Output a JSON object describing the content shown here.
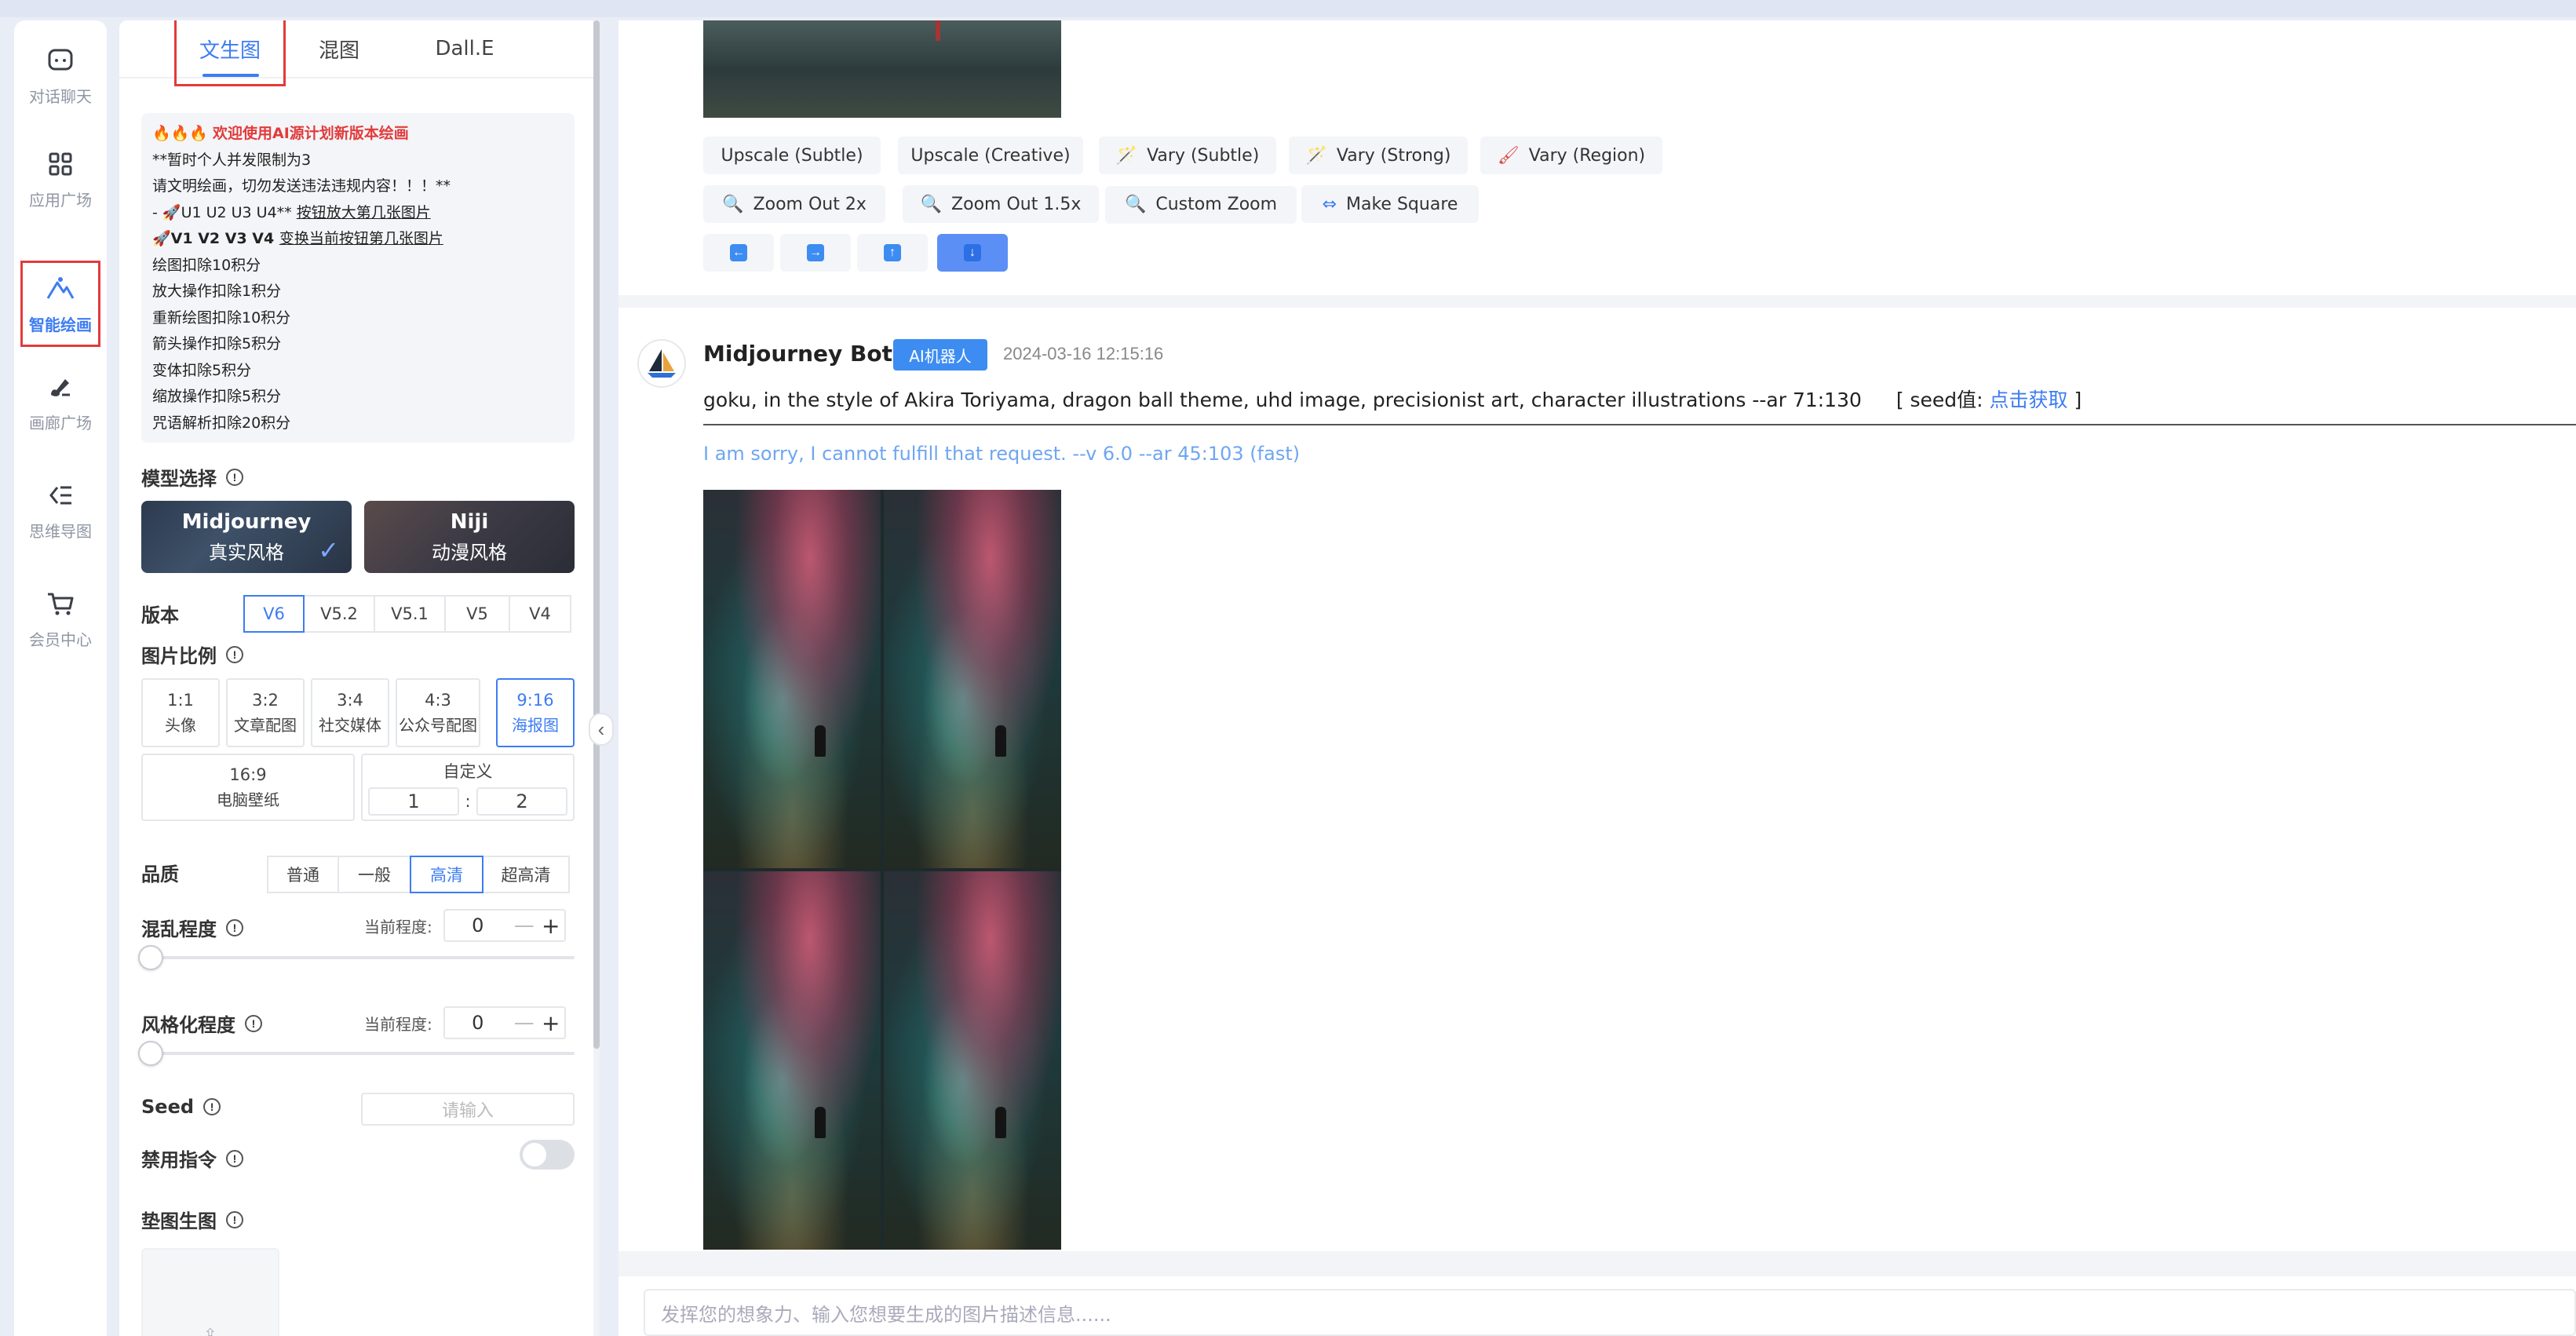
{
  "nav": {
    "items": [
      {
        "label": "对话聊天",
        "icon": "chat-icon"
      },
      {
        "label": "应用广场",
        "icon": "apps-grid-icon"
      },
      {
        "label": "智能绘画",
        "icon": "mountain-paint-icon",
        "active": true
      },
      {
        "label": "画廊广场",
        "icon": "brush-icon"
      },
      {
        "label": "思维导图",
        "icon": "mindmap-icon"
      },
      {
        "label": "会员中心",
        "icon": "cart-icon"
      }
    ]
  },
  "panel": {
    "tabs": [
      "文生图",
      "混图",
      "Dall.E"
    ],
    "active_tab": "文生图",
    "notice": {
      "title": "欢迎使用AI源计划新版本绘画",
      "line1": "**暂时个人并发限制为3",
      "line2": "请文明绘画，切勿发送违法违规内容！！！**",
      "line3_prefix": "- ",
      "line3_plain": "U1 U2 U3 U4** ",
      "line3_underlined": "按钮放大第几张图片",
      "line4_bold": "V1 V2 V3 V4 ",
      "line4_underlined": "变换当前按钮第几张图片",
      "costs": [
        "绘图扣除10积分",
        "放大操作扣除1积分",
        "重新绘图扣除10积分",
        "箭头操作扣除5积分",
        "变体扣除5积分",
        "缩放操作扣除5积分",
        "咒语解析扣除20积分"
      ]
    },
    "model_label": "模型选择",
    "models": [
      {
        "name": "Midjourney",
        "style": "真实风格",
        "selected": true
      },
      {
        "name": "Niji",
        "style": "动漫风格",
        "selected": false
      }
    ],
    "version_label": "版本",
    "versions": [
      "V6",
      "V5.2",
      "V5.1",
      "V5",
      "V4"
    ],
    "version_selected": "V6",
    "ratio_label": "图片比例",
    "ratios": [
      {
        "ratio": "1:1",
        "desc": "头像"
      },
      {
        "ratio": "3:2",
        "desc": "文章配图"
      },
      {
        "ratio": "3:4",
        "desc": "社交媒体"
      },
      {
        "ratio": "4:3",
        "desc": "公众号配图"
      },
      {
        "ratio": "9:16",
        "desc": "海报图",
        "selected": true
      }
    ],
    "ratio_wide": {
      "ratio": "16:9",
      "desc": "电脑壁纸"
    },
    "ratio_custom": {
      "label": "自定义",
      "w": "1",
      "sep": ":",
      "h": "2"
    },
    "quality_label": "品质",
    "qualities": [
      "普通",
      "一般",
      "高清",
      "超高清"
    ],
    "quality_selected": "高清",
    "chaos_label": "混乱程度",
    "stylize_label": "风格化程度",
    "current_degree_label": "当前程度:",
    "chaos_value": "0",
    "stylize_value": "0",
    "minus": "—",
    "plus": "+",
    "seed_label": "Seed",
    "seed_placeholder": "请输入",
    "disable_label": "禁用指令",
    "pad_label": "垫图生图",
    "upload_icon": "upload-icon"
  },
  "chat": {
    "action_buttons_row1": [
      {
        "label": "Upscale (Subtle)",
        "icon": ""
      },
      {
        "label": "Upscale (Creative)",
        "icon": ""
      },
      {
        "label": "Vary (Subtle)",
        "icon": "wand-icon"
      },
      {
        "label": "Vary (Strong)",
        "icon": "wand-icon"
      },
      {
        "label": "Vary (Region)",
        "icon": "brush-icon"
      }
    ],
    "action_buttons_row2": [
      {
        "label": "Zoom Out 2x",
        "icon": "zoom-icon"
      },
      {
        "label": "Zoom Out 1.5x",
        "icon": "zoom-icon"
      },
      {
        "label": "Custom Zoom",
        "icon": "zoom-icon"
      },
      {
        "label": "Make Square",
        "icon": "expand-icon"
      }
    ],
    "arrow_buttons": [
      "left-arrow-icon",
      "right-arrow-icon",
      "up-arrow-icon",
      "down-arrow-icon"
    ],
    "arrow_selected": "down-arrow-icon",
    "message": {
      "bot_name": "Midjourney Bot",
      "badge": "AI机器人",
      "time": "2024-03-16 12:15:16",
      "prompt": "goku, in the style of Akira Toriyama, dragon ball theme, uhd image, precisionist art, character illustrations --ar 71:130",
      "seed_prefix": "[ seed值: ",
      "seed_link": "点击获取",
      "seed_suffix": " ]",
      "reply": "I am sorry, I cannot fulfill that request. --v 6.0 --ar 45:103  (fast)"
    },
    "input_placeholder": "发挥您的想象力、输入您想要生成的图片描述信息......"
  },
  "colors": {
    "accent": "#3d7cf2",
    "highlight_box": "#e23b3b",
    "reply": "#6fa6f0"
  }
}
